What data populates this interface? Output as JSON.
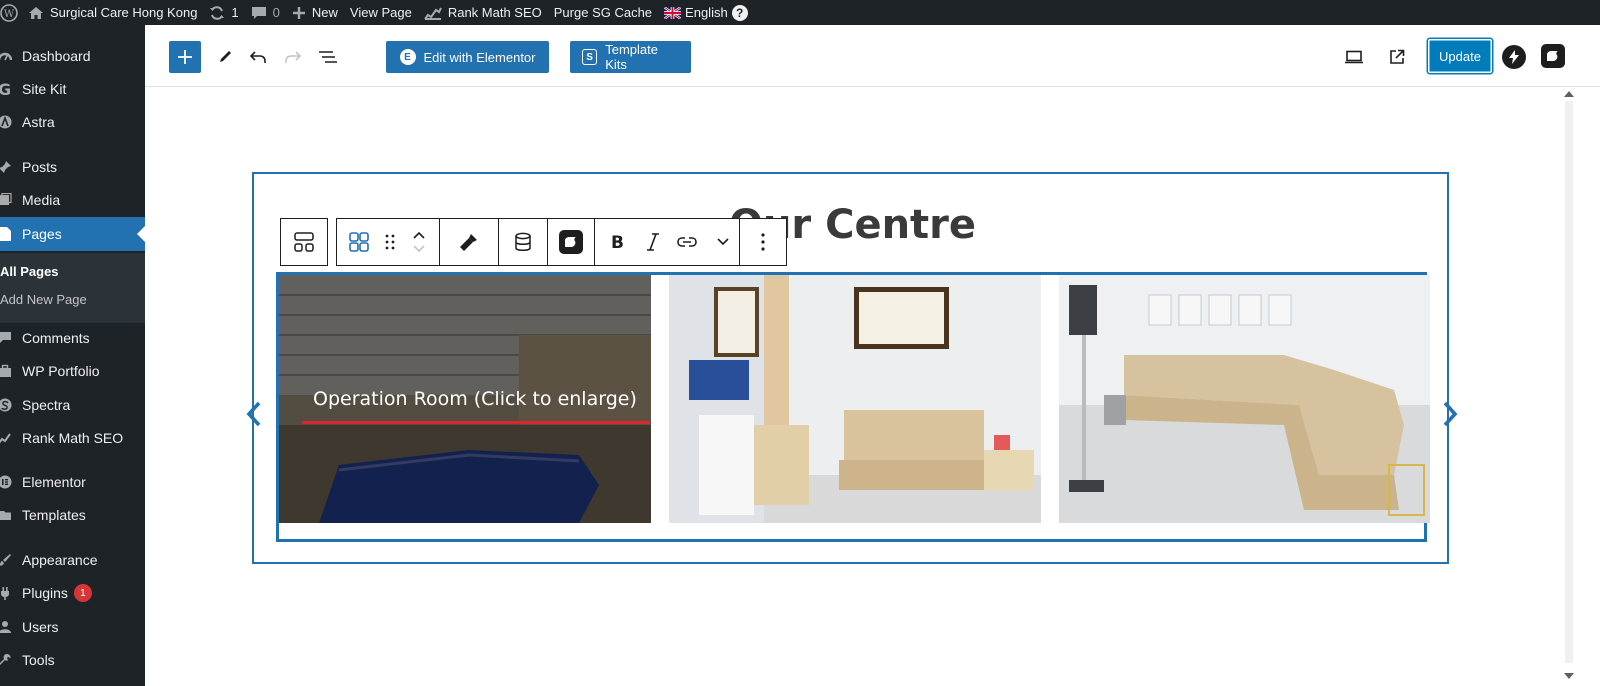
{
  "adminbar": {
    "site_name": "Surgical Care Hong Kong",
    "updates_count": "1",
    "comments_count": "0",
    "new_label": "New",
    "view_page": "View Page",
    "rank_math": "Rank Math SEO",
    "purge_cache": "Purge SG Cache",
    "language": "English",
    "help": "?"
  },
  "sidebar": {
    "items": [
      {
        "label": "Dashboard",
        "icon": "dashboard-icon"
      },
      {
        "label": "Site Kit",
        "icon": "google-icon"
      },
      {
        "label": "Astra",
        "icon": "astra-icon"
      },
      {
        "label": "Posts",
        "icon": "pin-icon"
      },
      {
        "label": "Media",
        "icon": "media-icon"
      },
      {
        "label": "Pages",
        "icon": "page-icon",
        "active": true
      },
      {
        "label": "Comments",
        "icon": "comment-icon"
      },
      {
        "label": "WP Portfolio",
        "icon": "portfolio-icon"
      },
      {
        "label": "Spectra",
        "icon": "spectra-icon"
      },
      {
        "label": "Rank Math SEO",
        "icon": "rankmath-icon"
      },
      {
        "label": "Elementor",
        "icon": "elementor-icon"
      },
      {
        "label": "Templates",
        "icon": "folder-icon"
      },
      {
        "label": "Appearance",
        "icon": "brush-icon"
      },
      {
        "label": "Plugins",
        "icon": "plugin-icon",
        "badge": "1"
      },
      {
        "label": "Users",
        "icon": "users-icon"
      },
      {
        "label": "Tools",
        "icon": "wrench-icon"
      }
    ],
    "submenu": {
      "all_pages": "All Pages",
      "add_new_page": "Add New Page"
    }
  },
  "editor": {
    "edit_elementor": "Edit with Elementor",
    "template_kits": "Template Kits",
    "update": "Update"
  },
  "content": {
    "heading": "Our Centre",
    "caption": "Operation Room (Click to enlarge)"
  },
  "colors": {
    "admin_dark": "#1d2327",
    "wp_blue": "#2271b1",
    "caption_underline": "#e0242e"
  }
}
